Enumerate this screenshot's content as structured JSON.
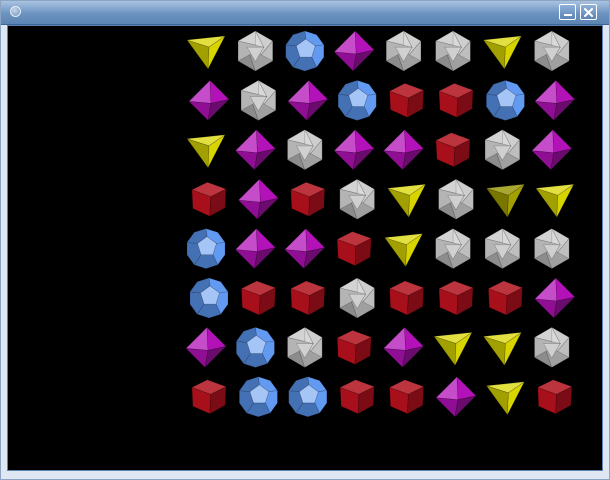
{
  "window": {
    "title": "",
    "buttons": [
      "minimize",
      "close"
    ]
  },
  "board": {
    "rows": 8,
    "columns": 8,
    "gem_types": {
      "Y": {
        "shape": "tetrahedron",
        "color": "#d8d400"
      },
      "S": {
        "shape": "icosahedron",
        "color": "#c8c8c8"
      },
      "B": {
        "shape": "dodecahedron",
        "color": "#5b95f0"
      },
      "P": {
        "shape": "octahedron",
        "color": "#b312b8"
      },
      "R": {
        "shape": "cube",
        "color": "#b0101c"
      }
    },
    "grid": [
      [
        "Y",
        "S",
        "B",
        "P",
        "S",
        "S",
        "Y",
        "S"
      ],
      [
        "P",
        "S",
        "P",
        "B",
        "R",
        "R",
        "B",
        "P"
      ],
      [
        "Y",
        "P",
        "S",
        "P",
        "P",
        "R",
        "S",
        "P"
      ],
      [
        "R",
        "P",
        "R",
        "S",
        "Y",
        "S",
        "Y",
        "Y"
      ],
      [
        "B",
        "P",
        "P",
        "R",
        "Y",
        "S",
        "S",
        "S"
      ],
      [
        "B",
        "R",
        "R",
        "S",
        "R",
        "R",
        "R",
        "P"
      ],
      [
        "P",
        "B",
        "S",
        "R",
        "P",
        "Y",
        "Y",
        "S"
      ],
      [
        "R",
        "B",
        "B",
        "R",
        "R",
        "P",
        "Y",
        "R"
      ]
    ],
    "highlighted": [
      [
        3,
        6
      ]
    ]
  }
}
